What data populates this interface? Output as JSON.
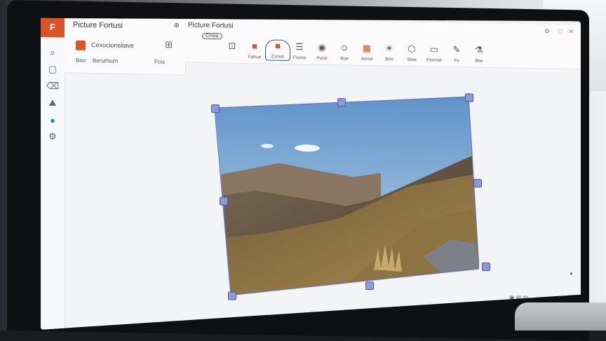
{
  "app": {
    "logo_letter": "F"
  },
  "panel": {
    "title": "Picture Fortusi",
    "item_name": "Cexocionsitave",
    "row_left": "Boo",
    "row_mid": "Beruthium",
    "row_right": "Fois"
  },
  "ribbon": {
    "title": "Picture Fortusi",
    "sub_label": "Cmoa",
    "tools": [
      {
        "label": "",
        "icon": "crop-frame-icon"
      },
      {
        "label": "Fatrue",
        "icon": "picture-red-icon"
      },
      {
        "label": "Crmet",
        "icon": "crop-red-icon"
      },
      {
        "label": "Froms",
        "icon": "list-icon"
      },
      {
        "label": "Puno",
        "icon": "eye-icon"
      },
      {
        "label": "Bue",
        "icon": "person-icon"
      },
      {
        "label": "Aonoi",
        "icon": "picture-icon"
      },
      {
        "label": "Brts",
        "icon": "brightness-icon"
      },
      {
        "label": "Stoe",
        "icon": "shape-icon"
      },
      {
        "label": "Fonmie",
        "icon": "frame-icon"
      },
      {
        "label": "Fu",
        "icon": "pen-icon"
      },
      {
        "label": "Biw",
        "icon": "flask-icon"
      }
    ]
  },
  "colors": {
    "accent": "#d9532b",
    "selection": "#8d99d8",
    "active_outline": "#2457b8"
  }
}
